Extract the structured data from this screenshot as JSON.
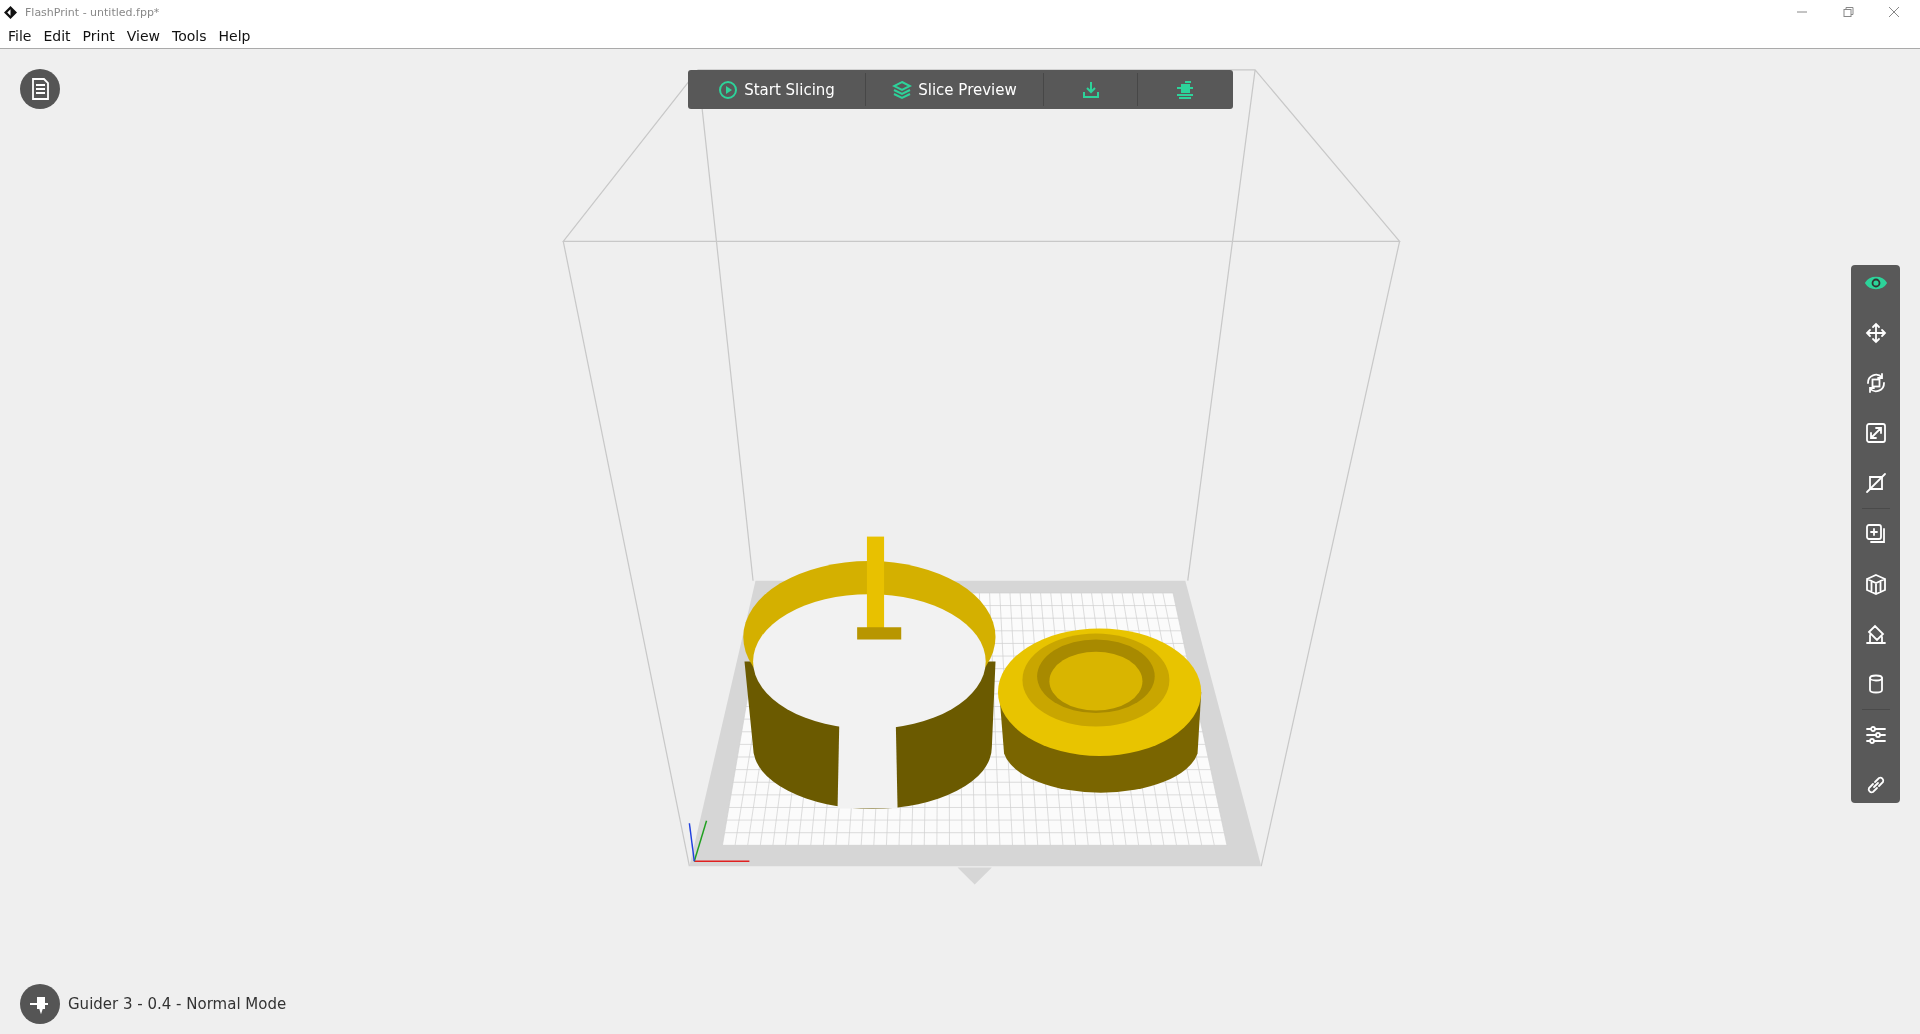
{
  "window": {
    "title": "FlashPrint - untitled.fpp*"
  },
  "menu": [
    "File",
    "Edit",
    "Print",
    "View",
    "Tools",
    "Help"
  ],
  "toolbar": [
    {
      "kind": "start",
      "label": "Start Slicing"
    },
    {
      "kind": "preview",
      "label": "Slice Preview"
    },
    {
      "kind": "export"
    },
    {
      "kind": "print"
    }
  ],
  "sidebar": {
    "groups": [
      [
        {
          "kind": "view",
          "selected": true
        },
        {
          "kind": "move",
          "selected": false
        },
        {
          "kind": "rotate",
          "selected": false
        },
        {
          "kind": "scale",
          "selected": false
        },
        {
          "kind": "cut",
          "selected": false
        }
      ],
      [
        {
          "kind": "duplicate",
          "selected": false
        },
        {
          "kind": "supports",
          "selected": false
        },
        {
          "kind": "layflat",
          "selected": false
        },
        {
          "kind": "cylinder",
          "selected": false
        }
      ],
      [
        {
          "kind": "settings",
          "selected": false
        },
        {
          "kind": "link",
          "selected": false
        }
      ]
    ]
  },
  "status": {
    "printer": "Guider 3 - 0.4 - Normal Mode"
  }
}
